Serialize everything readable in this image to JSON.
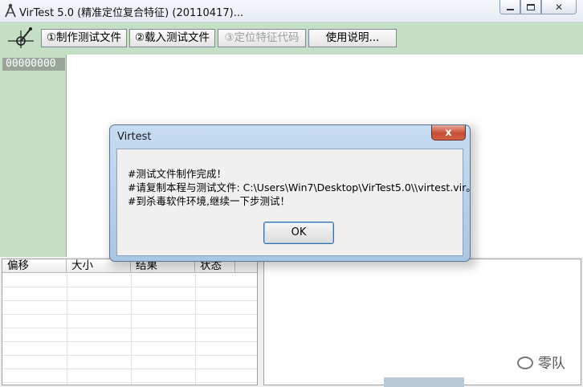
{
  "window": {
    "title": "VirTest 5.0 (精准定位复合特征) (20110417)...",
    "controls": [
      "minimize-icon",
      "maximize-icon",
      "close-icon"
    ]
  },
  "toolbar": {
    "buttons": [
      {
        "label": "①制作测试文件",
        "enabled": true
      },
      {
        "label": "②载入测试文件",
        "enabled": true
      },
      {
        "label": "③定位特征代码",
        "enabled": false
      },
      {
        "label": "使用说明...",
        "enabled": true
      }
    ]
  },
  "hex_view": {
    "offset": "00000000"
  },
  "result_list": {
    "columns": [
      "偏移",
      "大小",
      "结果",
      "状态"
    ]
  },
  "watermark": {
    "text": "零队"
  },
  "dialog": {
    "title": "Virtest",
    "close_label": "x",
    "lines": [
      "#测试文件制作完成！",
      "#请复制本程与测试文件: C:\\Users\\Win7\\Desktop\\VirTest5.0\\\\virtest.vir。",
      "#到杀毒软件环境,继续一下步测试！"
    ],
    "ok_label": "OK"
  },
  "colors": {
    "panel_green": "#c5dfc5",
    "dialog_frame": "#b9d1ea",
    "close_red": "#c74c32"
  }
}
